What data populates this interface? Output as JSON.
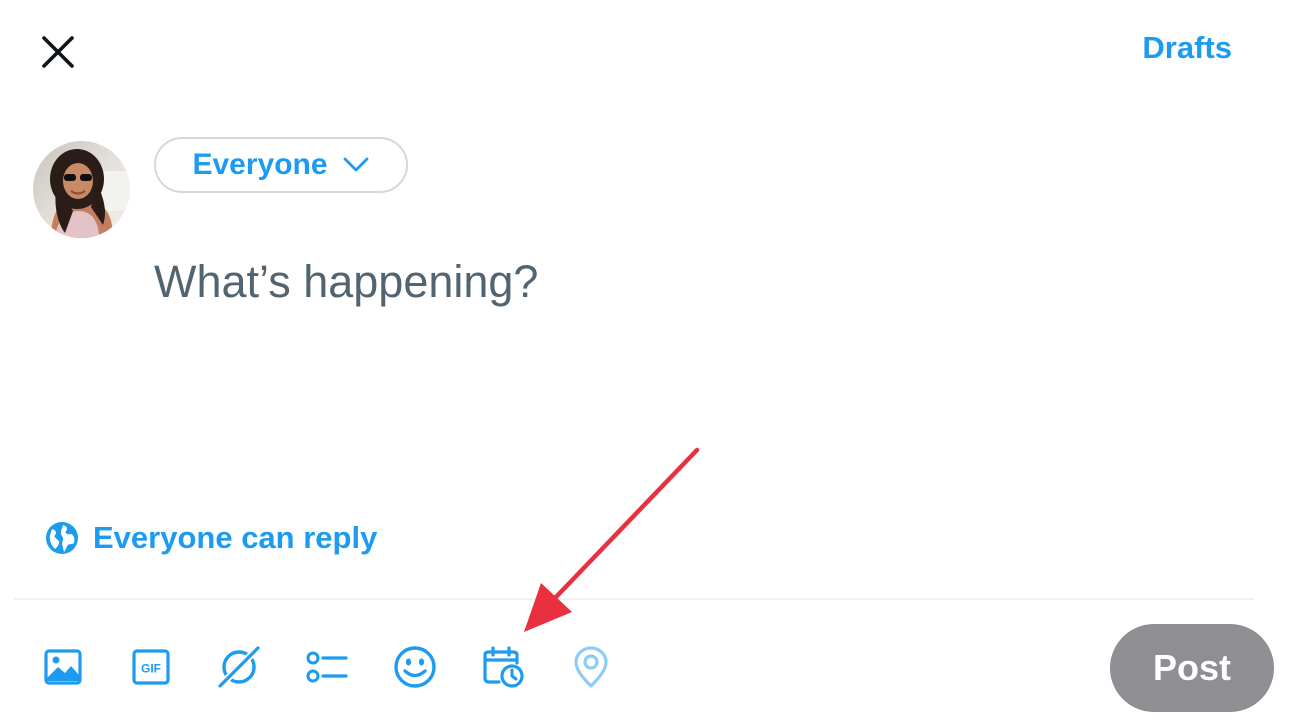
{
  "header": {
    "close_icon": "close-icon",
    "drafts_label": "Drafts"
  },
  "composer": {
    "audience_label": "Everyone",
    "placeholder": "What’s happening?",
    "value": "",
    "reply_setting_label": "Everyone can reply"
  },
  "toolbar": {
    "tools": [
      {
        "icon": "image-icon",
        "enabled": true
      },
      {
        "icon": "gif-icon",
        "label": "GIF",
        "enabled": true
      },
      {
        "icon": "grok-icon",
        "enabled": true
      },
      {
        "icon": "poll-icon",
        "enabled": true
      },
      {
        "icon": "emoji-icon",
        "enabled": true
      },
      {
        "icon": "schedule-icon",
        "enabled": true
      },
      {
        "icon": "location-icon",
        "enabled": false
      }
    ],
    "post_label": "Post"
  },
  "annotation": {
    "arrow_color": "#e8303f",
    "points_to": "schedule-icon"
  },
  "colors": {
    "accent": "#1d9bf0",
    "post_button_disabled": "#8e8e93",
    "placeholder_text": "#536471"
  }
}
